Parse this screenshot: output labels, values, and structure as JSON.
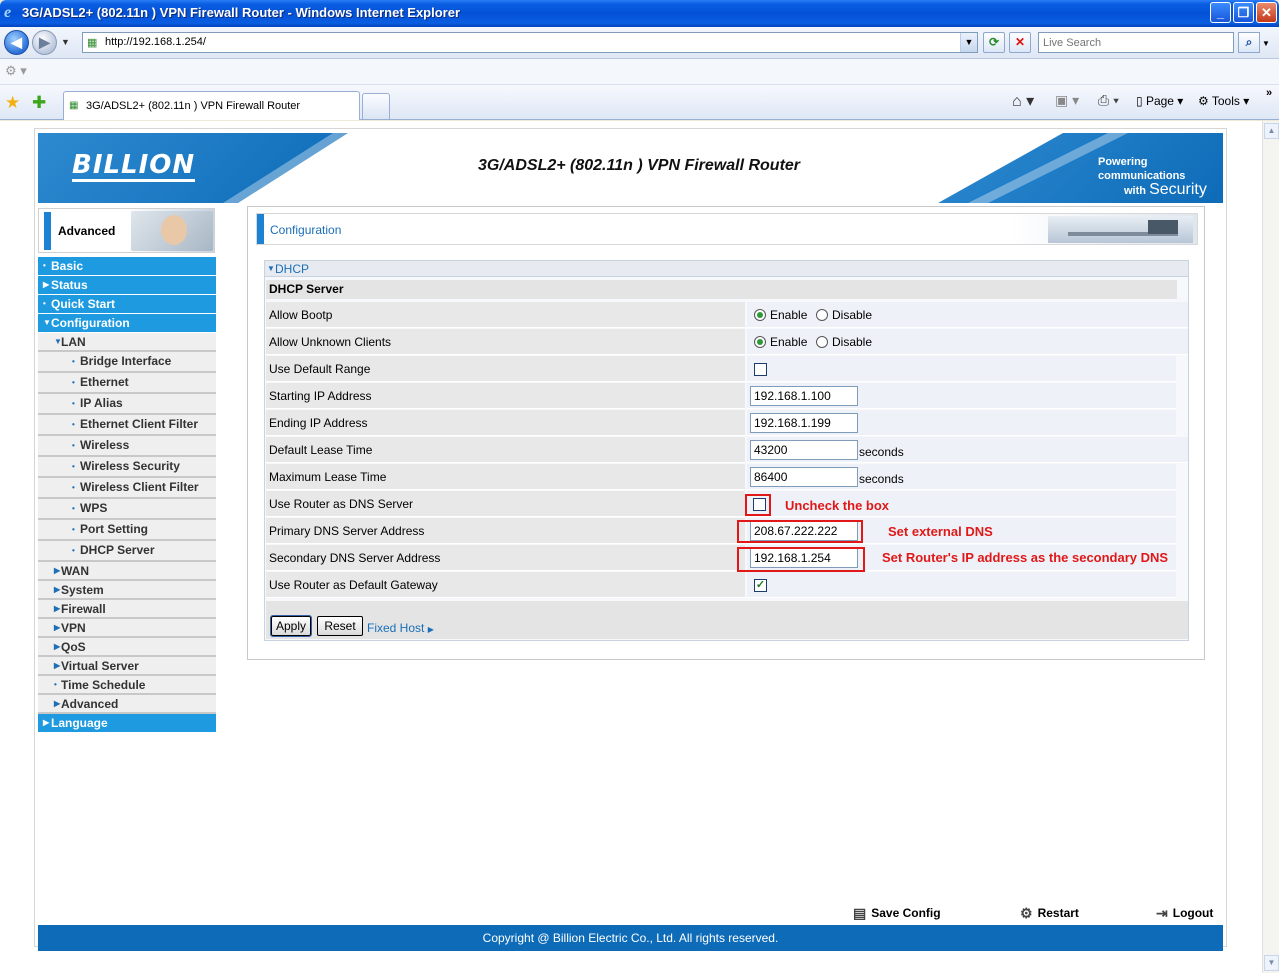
{
  "window": {
    "title": "3G/ADSL2+ (802.11n ) VPN Firewall Router - Windows Internet Explorer",
    "min_glyph": "_",
    "max_glyph": "❐",
    "close_glyph": "✕"
  },
  "browser": {
    "url": "http://192.168.1.254/",
    "search_placeholder": "Live Search",
    "tab_label": "3G/ADSL2+ (802.11n ) VPN Firewall Router",
    "page_menu": "Page",
    "tools_menu": "Tools"
  },
  "banner": {
    "logo": "BILLION",
    "product": "3G/ADSL2+ (802.11n ) VPN Firewall Router",
    "slogan_top": "Powering communications",
    "slogan_with": "with",
    "slogan_security": "Security"
  },
  "sidebar": {
    "mode_label": "Advanced",
    "items": [
      {
        "label": "Basic",
        "level": "top"
      },
      {
        "label": "Status",
        "level": "top"
      },
      {
        "label": "Quick Start",
        "level": "top"
      },
      {
        "label": "Configuration",
        "level": "top"
      },
      {
        "label": "LAN",
        "level": "sub"
      },
      {
        "label": "Bridge Interface",
        "level": "leaf"
      },
      {
        "label": "Ethernet",
        "level": "leaf"
      },
      {
        "label": "IP Alias",
        "level": "leaf"
      },
      {
        "label": "Ethernet Client Filter",
        "level": "leaf"
      },
      {
        "label": "Wireless",
        "level": "leaf"
      },
      {
        "label": "Wireless Security",
        "level": "leaf"
      },
      {
        "label": "Wireless Client Filter",
        "level": "leaf"
      },
      {
        "label": "WPS",
        "level": "leaf"
      },
      {
        "label": "Port Setting",
        "level": "leaf"
      },
      {
        "label": "DHCP Server",
        "level": "leaf"
      },
      {
        "label": "WAN",
        "level": "sub"
      },
      {
        "label": "System",
        "level": "sub"
      },
      {
        "label": "Firewall",
        "level": "sub"
      },
      {
        "label": "VPN",
        "level": "sub"
      },
      {
        "label": "QoS",
        "level": "sub"
      },
      {
        "label": "Virtual Server",
        "level": "sub"
      },
      {
        "label": "Time Schedule",
        "level": "sub"
      },
      {
        "label": "Advanced",
        "level": "sub"
      },
      {
        "label": "Language",
        "level": "top"
      }
    ]
  },
  "main": {
    "header": "Configuration",
    "section_title": "DHCP",
    "group_title": "DHCP Server",
    "enable_label": "Enable",
    "disable_label": "Disable",
    "seconds_label": "seconds",
    "fields": {
      "allow_bootp": {
        "label": "Allow Bootp",
        "value": "Enable"
      },
      "allow_unknown": {
        "label": "Allow Unknown Clients",
        "value": "Enable"
      },
      "use_default_range": {
        "label": "Use Default Range",
        "checked": false
      },
      "start_ip": {
        "label": "Starting IP Address",
        "value": "192.168.1.100"
      },
      "end_ip": {
        "label": "Ending IP Address",
        "value": "192.168.1.199"
      },
      "default_lease": {
        "label": "Default Lease Time",
        "value": "43200"
      },
      "max_lease": {
        "label": "Maximum Lease Time",
        "value": "86400"
      },
      "router_dns": {
        "label": "Use Router as DNS Server",
        "checked": false
      },
      "primary_dns": {
        "label": "Primary DNS Server Address",
        "value": "208.67.222.222"
      },
      "secondary_dns": {
        "label": "Secondary DNS Server Address",
        "value": "192.168.1.254"
      },
      "default_gateway": {
        "label": "Use Router as Default Gateway",
        "checked": true
      }
    },
    "apply_label": "Apply",
    "reset_label": "Reset",
    "fixed_host_label": "Fixed Host"
  },
  "annotations": {
    "uncheck": "Uncheck the box",
    "external_dns": "Set external DNS",
    "secondary": "Set Router's IP address as the secondary DNS"
  },
  "footer": {
    "save": "Save Config",
    "restart": "Restart",
    "logout": "Logout",
    "copyright": "Copyright @ Billion Electric Co., Ltd. All rights reserved."
  },
  "colors": {
    "accent_blue": "#1e9ae0",
    "banner_blue": "#0d6bb8",
    "annotation_red": "#e01818"
  }
}
